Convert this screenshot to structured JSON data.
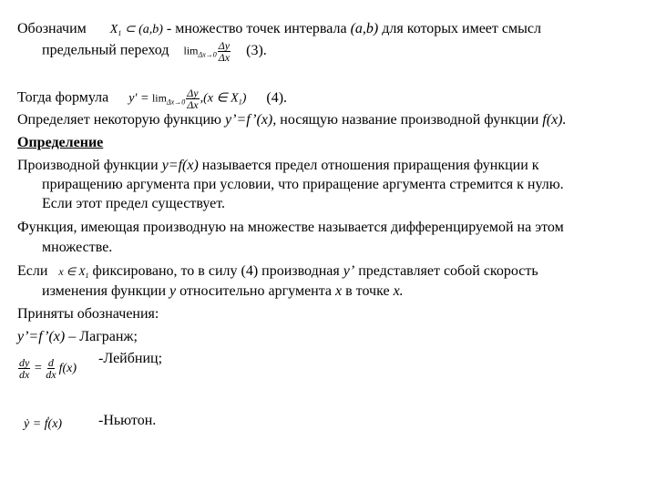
{
  "paragraphs": {
    "p1_a": "Обозначим",
    "p1_formula": "X₁ ⊂ (a,b)",
    "p1_b": " - множество точек интервала ",
    "p1_interval": "(a,b)",
    "p1_c": "  для которых имеет смысл",
    "p1_line2": "предельный переход",
    "p1_ref": "(3).",
    "p2_a": "Тогда формула",
    "p2_ref": "(4).",
    "p3_a": "Определяет некоторую функцию ",
    "p3_expr": "y’=f’(x),",
    "p3_b": " носящую название производной функции ",
    "p3_fx": "f(x).",
    "definition_heading": "Определение",
    "p4_a": "Производной функции ",
    "p4_expr": "y=f(x)",
    "p4_b": " называется предел отношения приращения функции к",
    "p4_line2": "приращению аргумента при условии, что приращение аргумента стремится к нулю.",
    "p4_line3": "Если этот предел существует.",
    "p5_line1": "Функция, имеющая производную на множестве  называется дифференцируемой на этом",
    "p5_line2": "множестве.",
    "p6_a": "Если",
    "p6_b": "фиксировано, то в силу (4) производная ",
    "p6_yprime": "y’",
    "p6_c": " представляет собой скорость",
    "p6_line2_a": "изменения функции ",
    "p6_y": "y",
    "p6_line2_b": "  относительно аргумента ",
    "p6_x1": "x",
    "p6_line2_c": " в точке ",
    "p6_x2": "x.",
    "notation_heading": "Приняты обозначения:",
    "lagrange_expr": "y’=f’(x)",
    "lagrange_label": " – Лагранж;",
    "leibniz_label": "-Лейбниц;",
    "newton_label": "-Ньютон."
  },
  "formulas": {
    "f1_x": "X",
    "f1_sub": "1",
    "f1_rest": " ⊂ (a,b)",
    "f3_lim": "lim",
    "f3_sub": "Δx→0",
    "f3_num": "Δy",
    "f3_den": "Δx",
    "f4_lhs": "y′ = ",
    "f4_lim": "lim",
    "f4_sub": "Δx→0",
    "f4_num": "Δy",
    "f4_den": "Δx",
    "f4_rest": ",(x ∈ X",
    "f4_rsub": "1",
    "f4_close": ")",
    "f6_expr": "x ∈ X",
    "f6_sub": "1",
    "leib_num1": "dy",
    "leib_den1": "dx",
    "leib_eq": " = ",
    "leib_num2": "d",
    "leib_den2": "dx",
    "leib_fx": "f(x)",
    "newton_expr": "ẏ = ḟ(x)"
  }
}
